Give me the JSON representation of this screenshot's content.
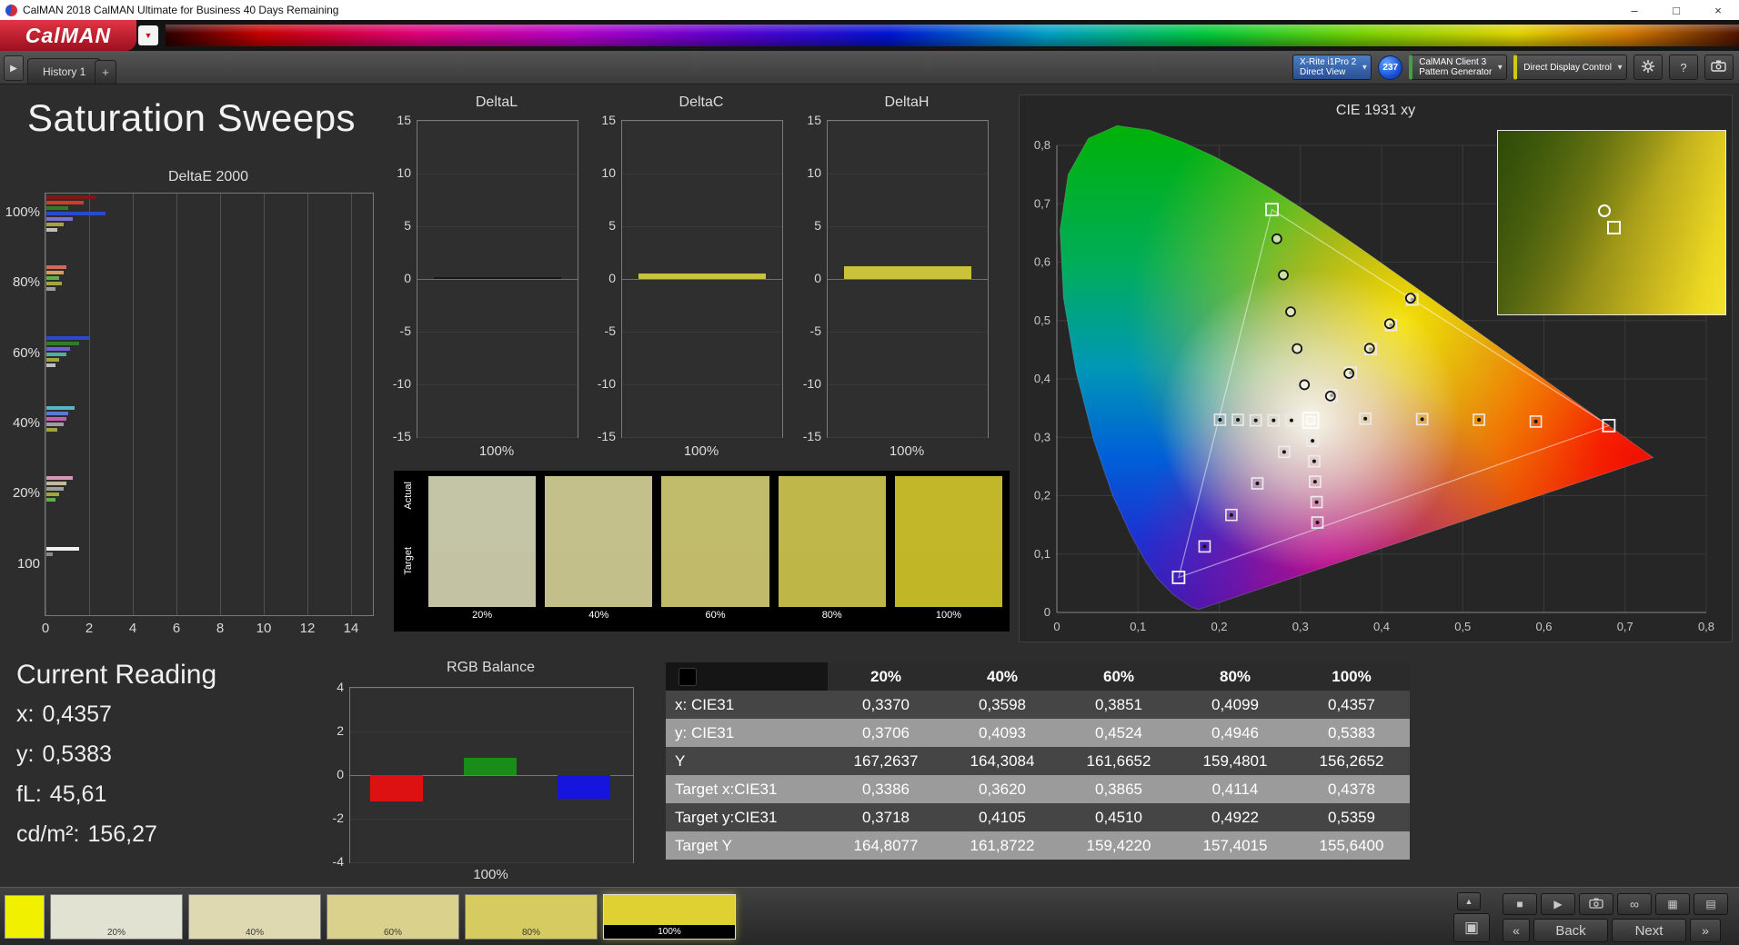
{
  "window": {
    "title": "CalMAN 2018 CalMAN Ultimate for Business 40 Days Remaining",
    "controls": {
      "minimize": "–",
      "maximize": "□",
      "close": "×"
    }
  },
  "brand": {
    "logo_text": "CalMAN",
    "accent": "#c01525"
  },
  "tabs": {
    "history": "History 1",
    "add": "+"
  },
  "toolbar": {
    "panel_arrow": "▶",
    "meter_line1": "X-Rite i1Pro 2",
    "meter_line2": "Direct View",
    "badge": "237",
    "pg_line1": "CalMAN Client 3",
    "pg_line2": "Pattern Generator",
    "display_control": "Direct Display Control",
    "arrow": "▼",
    "help_label": "?"
  },
  "page": {
    "title": "Saturation Sweeps"
  },
  "current_reading": {
    "title": "Current Reading",
    "lines": [
      {
        "label": "x:",
        "value": "0,4357"
      },
      {
        "label": "y:",
        "value": "0,5383"
      },
      {
        "label": "fL:",
        "value": "45,61"
      },
      {
        "label": "cd/m²:",
        "value": "156,27"
      }
    ]
  },
  "swatch_panel": {
    "row_labels": [
      "Actual",
      "Target"
    ],
    "columns": [
      {
        "label": "20%",
        "actual": "#c4c4a6",
        "target": "#c3c3a4"
      },
      {
        "label": "40%",
        "actual": "#c4c08c",
        "target": "#c3bf8a"
      },
      {
        "label": "60%",
        "actual": "#c1bb6c",
        "target": "#c0ba6a"
      },
      {
        "label": "80%",
        "actual": "#c0b74a",
        "target": "#bfb648"
      },
      {
        "label": "100%",
        "actual": "#c1b728",
        "target": "#c0b626"
      }
    ]
  },
  "table": {
    "headers": [
      "",
      "20%",
      "40%",
      "60%",
      "80%",
      "100%"
    ],
    "rows": [
      [
        "x: CIE31",
        "0,3370",
        "0,3598",
        "0,3851",
        "0,4099",
        "0,4357"
      ],
      [
        "y: CIE31",
        "0,3706",
        "0,4093",
        "0,4524",
        "0,4946",
        "0,5383"
      ],
      [
        "Y",
        "167,2637",
        "164,3084",
        "161,6652",
        "159,4801",
        "156,2652"
      ],
      [
        "Target x:CIE31",
        "0,3386",
        "0,3620",
        "0,3865",
        "0,4114",
        "0,4378"
      ],
      [
        "Target y:CIE31",
        "0,3718",
        "0,4105",
        "0,4510",
        "0,4922",
        "0,5359"
      ],
      [
        "Target Y",
        "164,8077",
        "161,8722",
        "159,4220",
        "157,4015",
        "155,6400"
      ]
    ]
  },
  "bottom_bar": {
    "color_chip": "#f0f000",
    "patterns": [
      {
        "label": "20%",
        "color": "#e2e2d2",
        "selected": false
      },
      {
        "label": "40%",
        "color": "#ded9b0",
        "selected": false
      },
      {
        "label": "60%",
        "color": "#dad28c",
        "selected": false
      },
      {
        "label": "80%",
        "color": "#d6cb60",
        "selected": false
      },
      {
        "label": "100%",
        "color": "#dfd132",
        "selected": true
      }
    ],
    "back_label": "Back",
    "next_label": "Next",
    "icons": {
      "eject": "▲",
      "target": "▣",
      "stop": "■",
      "play": "▶",
      "loop": "∞",
      "grid": "▦",
      "list": "▤",
      "prev": "«",
      "next": "»"
    }
  },
  "chart_data": [
    {
      "name": "deltae2000",
      "type": "bar",
      "orientation": "horizontal",
      "title": "DeltaE 2000",
      "xlim": [
        0,
        15
      ],
      "xticks": [
        "0",
        "2",
        "4",
        "6",
        "8",
        "10",
        "12",
        "14"
      ],
      "groups": [
        {
          "label": "100%",
          "bars": [
            {
              "color": "#7e1818",
              "value": 2.3
            },
            {
              "color": "#d23a2a",
              "value": 1.7
            },
            {
              "color": "#2f7d2a",
              "value": 1.0
            },
            {
              "color": "#2b49cf",
              "value": 2.7
            },
            {
              "color": "#7a6fd2",
              "value": 1.2
            },
            {
              "color": "#a4a43e",
              "value": 0.8
            },
            {
              "color": "#c0c0c0",
              "value": 0.5
            }
          ]
        },
        {
          "label": "80%",
          "bars": [
            {
              "color": "#d26a5a",
              "value": 0.9
            },
            {
              "color": "#d2a05a",
              "value": 0.8
            },
            {
              "color": "#5fae52",
              "value": 0.6
            },
            {
              "color": "#a4a43e",
              "value": 0.7
            },
            {
              "color": "#9e9e9e",
              "value": 0.4
            }
          ]
        },
        {
          "label": "60%",
          "bars": [
            {
              "color": "#2b49cf",
              "value": 2.0
            },
            {
              "color": "#2f7d2a",
              "value": 1.5
            },
            {
              "color": "#6f5fd2",
              "value": 1.1
            },
            {
              "color": "#4faea0",
              "value": 0.9
            },
            {
              "color": "#a4a43e",
              "value": 0.6
            },
            {
              "color": "#bdbdbd",
              "value": 0.4
            }
          ]
        },
        {
          "label": "40%",
          "bars": [
            {
              "color": "#55b6c6",
              "value": 1.3
            },
            {
              "color": "#5a7ad2",
              "value": 1.0
            },
            {
              "color": "#c65ab6",
              "value": 0.9
            },
            {
              "color": "#9e9e9e",
              "value": 0.8
            },
            {
              "color": "#a4a43e",
              "value": 0.5
            }
          ]
        },
        {
          "label": "20%",
          "bars": [
            {
              "color": "#d29ab6",
              "value": 1.2
            },
            {
              "color": "#c6b69a",
              "value": 0.9
            },
            {
              "color": "#9e9e9e",
              "value": 0.8
            },
            {
              "color": "#a4a43e",
              "value": 0.6
            },
            {
              "color": "#5fae52",
              "value": 0.4
            }
          ]
        },
        {
          "label": "100",
          "bars": [
            {
              "color": "#f0f0f0",
              "value": 1.5
            },
            {
              "color": "#8a8a8a",
              "value": 0.3
            }
          ]
        }
      ]
    },
    {
      "name": "deltal",
      "type": "bar",
      "title": "DeltaL",
      "ylim": [
        -15,
        15
      ],
      "yticks": [
        "15",
        "10",
        "5",
        "0",
        "-5",
        "-10",
        "-15"
      ],
      "categories": [
        "100%"
      ],
      "values": [
        0.1
      ],
      "bar_color": "#161616",
      "xlabel": "100%"
    },
    {
      "name": "deltac",
      "type": "bar",
      "title": "DeltaC",
      "ylim": [
        -15,
        15
      ],
      "yticks": [
        "15",
        "10",
        "5",
        "0",
        "-5",
        "-10",
        "-15"
      ],
      "categories": [
        "100%"
      ],
      "values": [
        0.5
      ],
      "bar_color": "#c9c23a",
      "xlabel": "100%"
    },
    {
      "name": "deltah",
      "type": "bar",
      "title": "DeltaH",
      "ylim": [
        -15,
        15
      ],
      "yticks": [
        "15",
        "10",
        "5",
        "0",
        "-5",
        "-10",
        "-15"
      ],
      "categories": [
        "100%"
      ],
      "values": [
        1.2
      ],
      "bar_color": "#c9c23a",
      "xlabel": "100%"
    },
    {
      "name": "rgb_balance",
      "type": "bar",
      "title": "RGB Balance",
      "ylim": [
        -4,
        4
      ],
      "yticks": [
        "4",
        "2",
        "0",
        "-2",
        "-4"
      ],
      "categories": [
        "Red",
        "Green",
        "Blue"
      ],
      "values": [
        -1.2,
        0.8,
        -1.1
      ],
      "colors": [
        "#dd1111",
        "#1a8c1a",
        "#1515dd"
      ],
      "xlabel": "100%"
    },
    {
      "name": "cie1931",
      "type": "scatter",
      "title": "CIE 1931 xy",
      "xlim": [
        0,
        0.8
      ],
      "ylim": [
        0,
        0.8
      ],
      "xticks": [
        "0",
        "0,1",
        "0,2",
        "0,3",
        "0,4",
        "0,5",
        "0,6",
        "0,7",
        "0,8"
      ],
      "yticks": [
        "0",
        "0,1",
        "0,2",
        "0,3",
        "0,4",
        "0,5",
        "0,6",
        "0,7",
        "0,8"
      ],
      "gamut_triangle": [
        [
          0.68,
          0.32
        ],
        [
          0.265,
          0.69
        ],
        [
          0.15,
          0.06
        ]
      ],
      "corner_squares": [
        [
          0.68,
          0.32
        ],
        [
          0.265,
          0.69
        ],
        [
          0.15,
          0.06
        ]
      ],
      "target_squares": [
        [
          0.3386,
          0.3718
        ],
        [
          0.362,
          0.4105
        ],
        [
          0.3865,
          0.451
        ],
        [
          0.4114,
          0.4922
        ],
        [
          0.4378,
          0.5359
        ],
        [
          0.38,
          0.332
        ],
        [
          0.45,
          0.331
        ],
        [
          0.52,
          0.33
        ],
        [
          0.59,
          0.327
        ],
        [
          0.289,
          0.329
        ],
        [
          0.267,
          0.329
        ],
        [
          0.245,
          0.329
        ],
        [
          0.223,
          0.33
        ],
        [
          0.201,
          0.33
        ],
        [
          0.28,
          0.275
        ],
        [
          0.247,
          0.221
        ],
        [
          0.215,
          0.167
        ],
        [
          0.182,
          0.113
        ],
        [
          0.315,
          0.294
        ],
        [
          0.317,
          0.259
        ],
        [
          0.318,
          0.224
        ],
        [
          0.32,
          0.189
        ],
        [
          0.321,
          0.154
        ]
      ],
      "measured_circles": [
        [
          0.337,
          0.3706
        ],
        [
          0.3598,
          0.4093
        ],
        [
          0.3851,
          0.4524
        ],
        [
          0.4099,
          0.4946
        ],
        [
          0.4357,
          0.5383
        ],
        [
          0.305,
          0.39
        ],
        [
          0.296,
          0.452
        ],
        [
          0.288,
          0.515
        ],
        [
          0.279,
          0.578
        ],
        [
          0.271,
          0.64
        ]
      ],
      "highlight": [
        0.3127,
        0.329
      ]
    }
  ]
}
